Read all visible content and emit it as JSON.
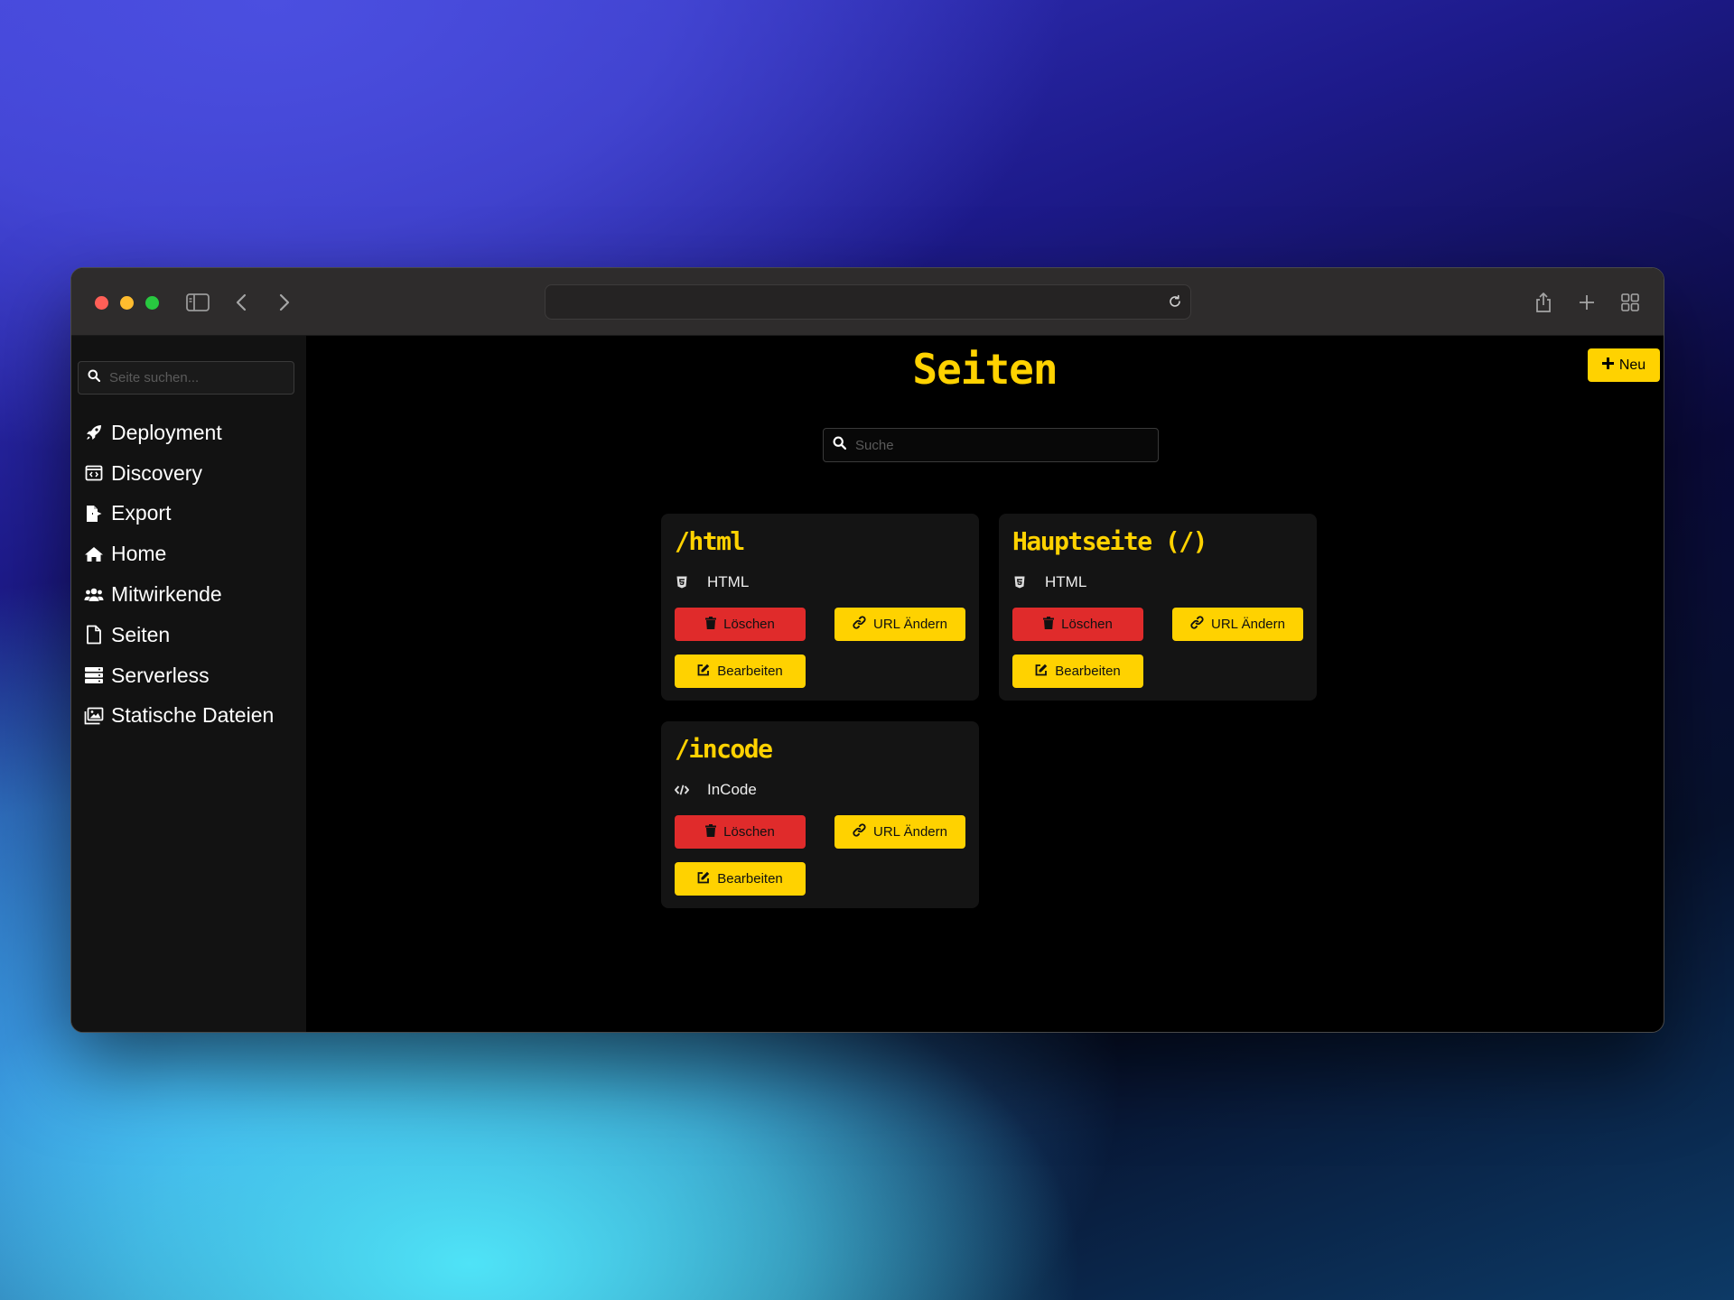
{
  "browser": {
    "url": ""
  },
  "sidebar": {
    "search_placeholder": "Seite suchen...",
    "items": [
      {
        "label": "Deployment",
        "icon": "rocket-icon"
      },
      {
        "label": "Discovery",
        "icon": "code-window-icon"
      },
      {
        "label": "Export",
        "icon": "file-export-icon"
      },
      {
        "label": "Home",
        "icon": "home-icon"
      },
      {
        "label": "Mitwirkende",
        "icon": "users-icon"
      },
      {
        "label": "Seiten",
        "icon": "file-icon"
      },
      {
        "label": "Serverless",
        "icon": "server-icon"
      },
      {
        "label": "Statische Dateien",
        "icon": "images-icon"
      }
    ]
  },
  "main": {
    "title": "Seiten",
    "new_label": "Neu",
    "search_placeholder": "Suche",
    "cards": [
      {
        "title": "/html",
        "type": "HTML",
        "type_icon": "html5-icon"
      },
      {
        "title": "Hauptseite (/)",
        "type": "HTML",
        "type_icon": "html5-icon"
      },
      {
        "title": "/incode",
        "type": "InCode",
        "type_icon": "code-icon"
      }
    ],
    "buttons": {
      "delete": "Löschen",
      "change_url": "URL Ändern",
      "edit": "Bearbeiten"
    }
  },
  "colors": {
    "accent": "#ffd200",
    "danger": "#e02b2b",
    "sidebar_bg": "#121212",
    "card_bg": "#141414"
  }
}
